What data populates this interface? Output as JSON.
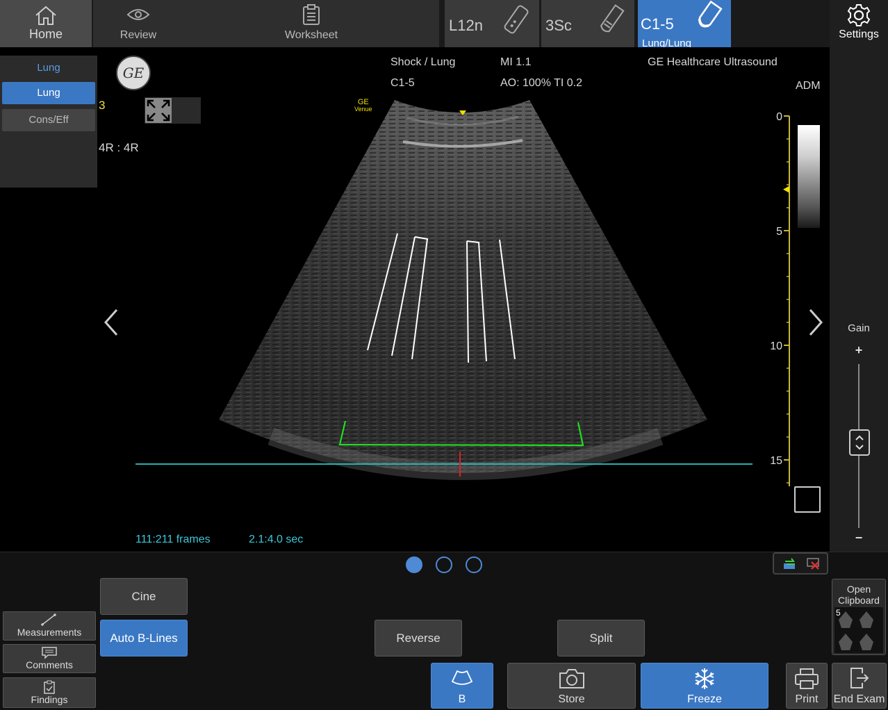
{
  "topbar": {
    "home_label": "Home",
    "review_label": "Review",
    "worksheet_label": "Worksheet",
    "settings_label": "Settings",
    "probes": [
      {
        "name": "L12n",
        "icon": "linear-probe-icon"
      },
      {
        "name": "3Sc",
        "icon": "sector-probe-icon"
      },
      {
        "name": "C1-5",
        "sub": "Lung/Lung",
        "icon": "curved-probe-icon"
      }
    ]
  },
  "left_panel": {
    "title": "Lung",
    "presets": [
      "Lung",
      "Cons/Eff"
    ],
    "selected": "Lung"
  },
  "image_info": {
    "logo_text": "GE",
    "preset_text": "Shock / Lung",
    "probe_text": "C1-5",
    "mi": "MI 1.1",
    "ao_ti": "AO: 100% TI 0.2",
    "brand": "GE Healthcare Ultrasound",
    "adm": "ADM",
    "zone_number": "3",
    "zoom": "4R : 4R",
    "venue_line1": "GE",
    "venue_line2": "Venue",
    "frames": "111:211 frames",
    "time": "2.1:4.0 sec",
    "depth_ticks": [
      "0",
      "5",
      "10",
      "15"
    ]
  },
  "gain": {
    "label": "Gain",
    "plus": "+",
    "minus": "−"
  },
  "bottom": {
    "cine_label": "Cine",
    "auto_blines_label": "Auto B-Lines",
    "reverse_label": "Reverse",
    "split_label": "Split",
    "measurements_label": "Measurements",
    "comments_label": "Comments",
    "findings_label": "Findings",
    "b_label": "B",
    "store_label": "Store",
    "freeze_label": "Freeze",
    "print_label": "Print",
    "end_exam_label": "End Exam",
    "clipboard_label_1": "Open",
    "clipboard_label_2": "Clipboard",
    "clipboard_count": "5",
    "page_dots": 3,
    "active_dot": 0
  },
  "colors": {
    "accent": "#3b78c4",
    "depth_scale": "#c8b43c",
    "bline": "#ffffff",
    "roi": "#22dd22",
    "pleural_line": "#2ab0b0",
    "marker": "#e02020",
    "frames_text": "#3cc8d8"
  }
}
